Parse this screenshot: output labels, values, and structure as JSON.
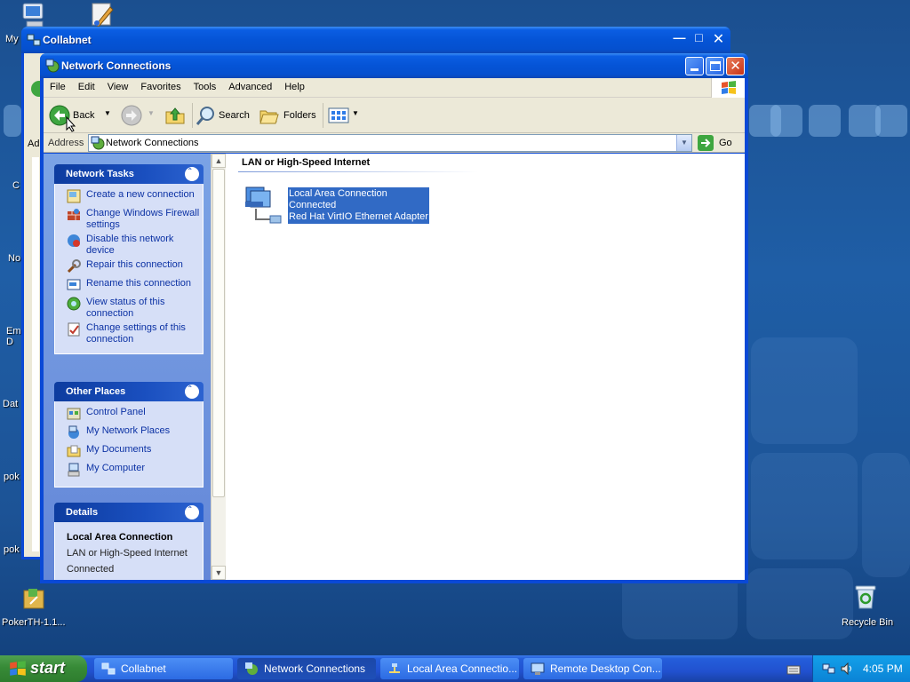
{
  "desktop": {
    "icons": [
      {
        "label": "My"
      },
      {
        "label": "C"
      },
      {
        "label": "No"
      },
      {
        "label": "Em D"
      },
      {
        "label": "Dat"
      },
      {
        "label": "pok"
      },
      {
        "label": "pok"
      },
      {
        "label": "PokerTH-1.1..."
      },
      {
        "label": "Recycle Bin"
      }
    ]
  },
  "back_window": {
    "title": "Collabnet",
    "address_fragment": "Ad"
  },
  "window": {
    "title": "Network Connections",
    "menu": [
      "File",
      "Edit",
      "View",
      "Favorites",
      "Tools",
      "Advanced",
      "Help"
    ],
    "toolbar": {
      "back": "Back",
      "search": "Search",
      "folders": "Folders"
    },
    "address": {
      "label": "Address",
      "value": "Network Connections",
      "go": "Go"
    },
    "network_tasks": {
      "title": "Network Tasks",
      "items": [
        {
          "label": "Create a new connection",
          "icon": "new-connection-icon"
        },
        {
          "label": "Change Windows Firewall settings",
          "icon": "firewall-icon"
        },
        {
          "label": "Disable this network device",
          "icon": "disable-network-icon"
        },
        {
          "label": "Repair this connection",
          "icon": "repair-icon"
        },
        {
          "label": "Rename this connection",
          "icon": "rename-icon"
        },
        {
          "label": "View status of this connection",
          "icon": "status-icon"
        },
        {
          "label": "Change settings of this connection",
          "icon": "settings-icon"
        }
      ]
    },
    "other_places": {
      "title": "Other Places",
      "items": [
        {
          "label": "Control Panel",
          "icon": "control-panel-icon"
        },
        {
          "label": "My Network Places",
          "icon": "network-places-icon"
        },
        {
          "label": "My Documents",
          "icon": "documents-icon"
        },
        {
          "label": "My Computer",
          "icon": "computer-icon"
        }
      ]
    },
    "details": {
      "title": "Details",
      "name": "Local Area Connection",
      "type": "LAN or High-Speed Internet",
      "status": "Connected"
    },
    "group_header": "LAN or High-Speed Internet",
    "connection": {
      "name": "Local Area Connection",
      "status": "Connected",
      "adapter": "Red Hat VirtIO Ethernet Adapter"
    }
  },
  "taskbar": {
    "start": "start",
    "tasks": [
      {
        "label": "Collabnet"
      },
      {
        "label": "Network Connections"
      },
      {
        "label": "Local Area Connectio..."
      },
      {
        "label": "Remote Desktop Con..."
      }
    ],
    "clock": "4:05 PM"
  },
  "colors": {
    "titlebar": "#0554d6",
    "task_link": "#0c32a4",
    "selection": "#316ac5"
  }
}
